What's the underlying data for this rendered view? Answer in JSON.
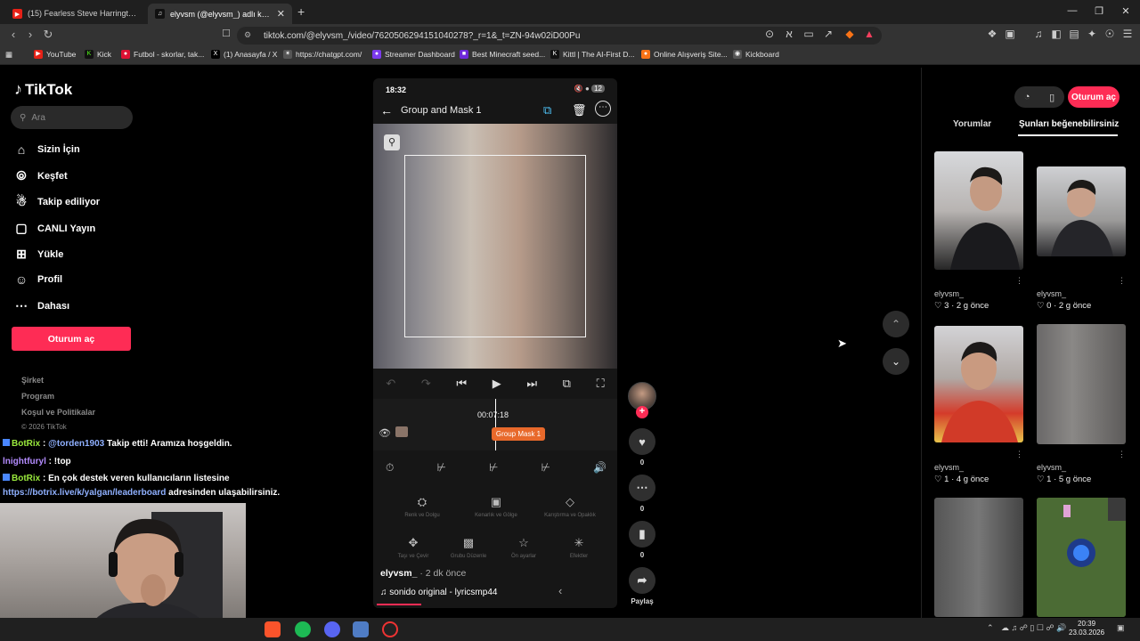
{
  "browser": {
    "tabs": [
      {
        "title": "(15) Fearless Steve Harrington ◎ (B…",
        "active": false
      },
      {
        "title": "elyvsm (@elyvsm_) adlı kullanıcının",
        "active": true
      }
    ],
    "url": "tiktok.com/@elyvsm_/video/7620506294151040278?_r=1&_t=ZN-94w02iD00Pu",
    "bookmarks": [
      "YouTube",
      "Kick",
      "Futbol - skorlar, tak...",
      "(1) Anasayfa / X",
      "https://chatgpt.com/",
      "Streamer Dashboard",
      "Best Minecraft seed...",
      "Kittl | The AI-First D...",
      "Online Alışveriş Site...",
      "Kickboard"
    ]
  },
  "tiktok": {
    "logo": "TikTok",
    "search_placeholder": "Ara",
    "nav": [
      "Sizin İçin",
      "Keşfet",
      "Takip ediliyor",
      "CANLI Yayın",
      "Yükle",
      "Profil",
      "Dahası"
    ],
    "login": "Oturum aç",
    "footer": [
      "Şirket",
      "Program",
      "Koşul ve Politikalar"
    ],
    "copyright": "© 2026 TikTok"
  },
  "chat": [
    {
      "user": "BotRix",
      "text": " : ",
      "mention": "@torden1903",
      "rest": " Takip etti! Aramıza hoşgeldin."
    },
    {
      "user": "lnightfuryl",
      "text": " : !top"
    },
    {
      "user": "BotRix",
      "text": " : En çok destek veren kullanıcıların listesine"
    },
    {
      "link": "https://botrix.live/k/yalgan/leaderboard",
      "rest": " adresinden ulaşabilirsiniz."
    }
  ],
  "phone": {
    "time": "18:32",
    "battery": "12",
    "edit_title": "Group and Mask 1",
    "timecode": "00:07:18",
    "clip_label": "Group Mask 1",
    "tool_labels": [
      "Renk ve Dolgu",
      "Kenarlık ve Gölge",
      "Karıştırma ve Opaklık",
      "Taşı ve Çevir",
      "Grubu Düzenle",
      "Ön ayarlar",
      "Efektler"
    ]
  },
  "video": {
    "author": "elyvsm_",
    "time": " · 2 dk önce",
    "music": "sonido original - lyricsmp44",
    "likes": "0",
    "comments": "0",
    "saves": "0",
    "share": "Paylaş"
  },
  "right": {
    "login": "Oturum aç",
    "tabs": [
      "Yorumlar",
      "Şunları beğenebilirsiniz"
    ],
    "items": [
      {
        "name": "elyvsm_",
        "meta": "♡ 3 · 2 g önce"
      },
      {
        "name": "elyvsm_",
        "meta": "♡ 0 · 2 g önce"
      },
      {
        "name": "elyvsm_",
        "meta": "♡ 1 · 4 g önce"
      },
      {
        "name": "elyvsm_",
        "meta": "♡ 1 · 5 g önce"
      }
    ]
  },
  "taskbar": {
    "time": "20:39",
    "date": "23.03.2026"
  }
}
